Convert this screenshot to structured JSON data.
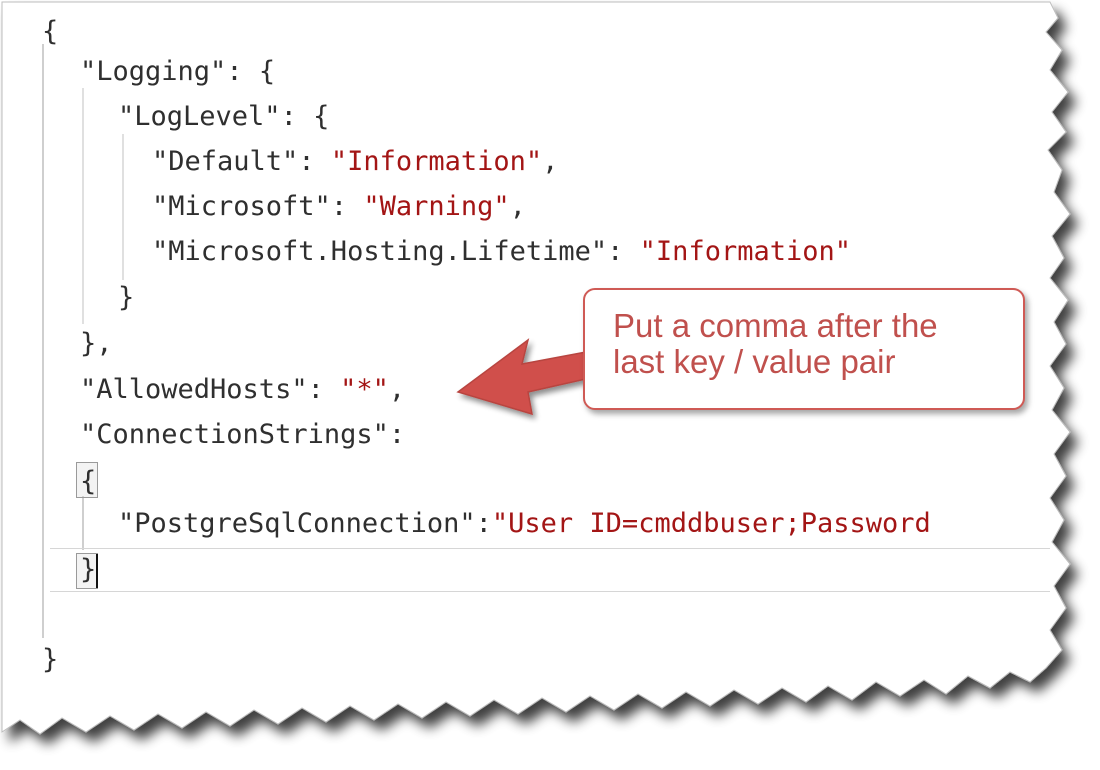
{
  "editor": {
    "lines": [
      {
        "id": "l1",
        "indent": 0,
        "parts": [
          {
            "t": "{",
            "c": "punc"
          }
        ]
      },
      {
        "id": "l2",
        "indent": 1,
        "parts": [
          {
            "t": "\"Logging\"",
            "c": "key"
          },
          {
            "t": ": {",
            "c": "punc"
          }
        ]
      },
      {
        "id": "l3",
        "indent": 2,
        "parts": [
          {
            "t": "\"LogLevel\"",
            "c": "key"
          },
          {
            "t": ": {",
            "c": "punc"
          }
        ]
      },
      {
        "id": "l4",
        "indent": 3,
        "parts": [
          {
            "t": "\"Default\"",
            "c": "key"
          },
          {
            "t": ": ",
            "c": "punc"
          },
          {
            "t": "\"Information\"",
            "c": "str"
          },
          {
            "t": ",",
            "c": "punc"
          }
        ]
      },
      {
        "id": "l5",
        "indent": 3,
        "parts": [
          {
            "t": "\"Microsoft\"",
            "c": "key"
          },
          {
            "t": ": ",
            "c": "punc"
          },
          {
            "t": "\"Warning\"",
            "c": "str"
          },
          {
            "t": ",",
            "c": "punc"
          }
        ]
      },
      {
        "id": "l6",
        "indent": 3,
        "parts": [
          {
            "t": "\"Microsoft.Hosting.Lifetime\"",
            "c": "key"
          },
          {
            "t": ": ",
            "c": "punc"
          },
          {
            "t": "\"Information\"",
            "c": "str"
          }
        ]
      },
      {
        "id": "l7",
        "indent": 2,
        "parts": [
          {
            "t": "}",
            "c": "punc"
          }
        ]
      },
      {
        "id": "l8",
        "indent": 1,
        "parts": [
          {
            "t": "},",
            "c": "punc"
          }
        ]
      },
      {
        "id": "l9",
        "indent": 1,
        "parts": [
          {
            "t": "\"AllowedHosts\"",
            "c": "key"
          },
          {
            "t": ": ",
            "c": "punc"
          },
          {
            "t": "\"*\"",
            "c": "str"
          },
          {
            "t": ",",
            "c": "punc"
          }
        ]
      },
      {
        "id": "l10",
        "indent": 1,
        "parts": [
          {
            "t": "\"ConnectionStrings\"",
            "c": "key"
          },
          {
            "t": ":",
            "c": "punc"
          }
        ]
      },
      {
        "id": "l11",
        "indent": 1,
        "parts": [
          {
            "t": "{",
            "c": "punc"
          }
        ]
      },
      {
        "id": "l12",
        "indent": 2,
        "parts": [
          {
            "t": "\"PostgreSqlConnection\"",
            "c": "key"
          },
          {
            "t": ":",
            "c": "punc"
          },
          {
            "t": "\"User ID=cmddbuser;Password",
            "c": "str"
          }
        ]
      },
      {
        "id": "l13",
        "indent": 1,
        "parts": [
          {
            "t": "}",
            "c": "punc"
          }
        ]
      },
      {
        "id": "l14",
        "indent": 0,
        "parts": [
          {
            "t": "",
            "c": "punc"
          }
        ]
      },
      {
        "id": "l15",
        "indent": 0,
        "parts": [
          {
            "t": "}",
            "c": "punc"
          }
        ]
      }
    ]
  },
  "callout": {
    "line1": "Put a comma after the",
    "line2": "last key / value pair",
    "color": "#c0504d"
  },
  "colors": {
    "string": "#a31515",
    "text": "#2f2f2f",
    "arrow": "#d0504b"
  }
}
